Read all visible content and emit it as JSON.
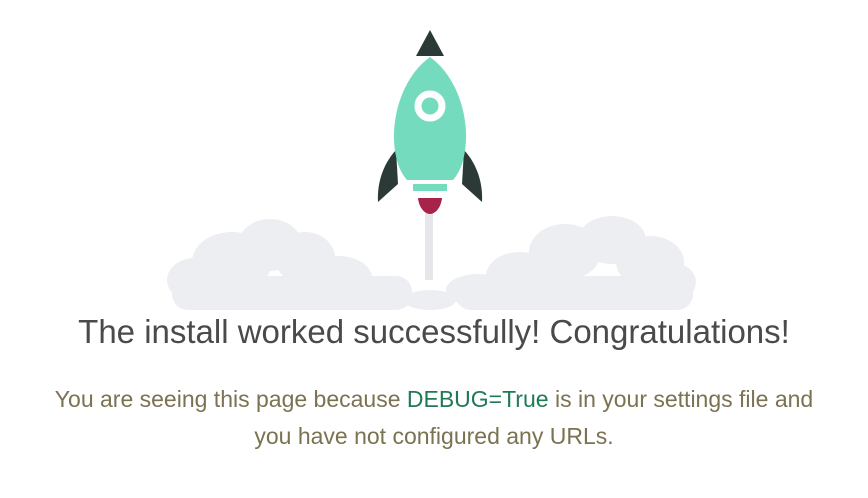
{
  "page": {
    "headline": "The install worked successfully! Congratulations!",
    "message": {
      "before": "You are seeing this page because ",
      "highlight": "DEBUG=True",
      "after": " is in your settings file and you have not configured any URLs."
    }
  },
  "illustration": {
    "icon": "rocket-launch-icon"
  },
  "colors": {
    "headline": "#4a4a4a",
    "message": "#7a7250",
    "debug_highlight": "#1f7a55",
    "rocket_body": "#74dbbe",
    "rocket_fins": "#2b3a36",
    "rocket_flame": "#a8234a",
    "smoke_trail": "#e6e7ea",
    "clouds": "#eceef1"
  }
}
